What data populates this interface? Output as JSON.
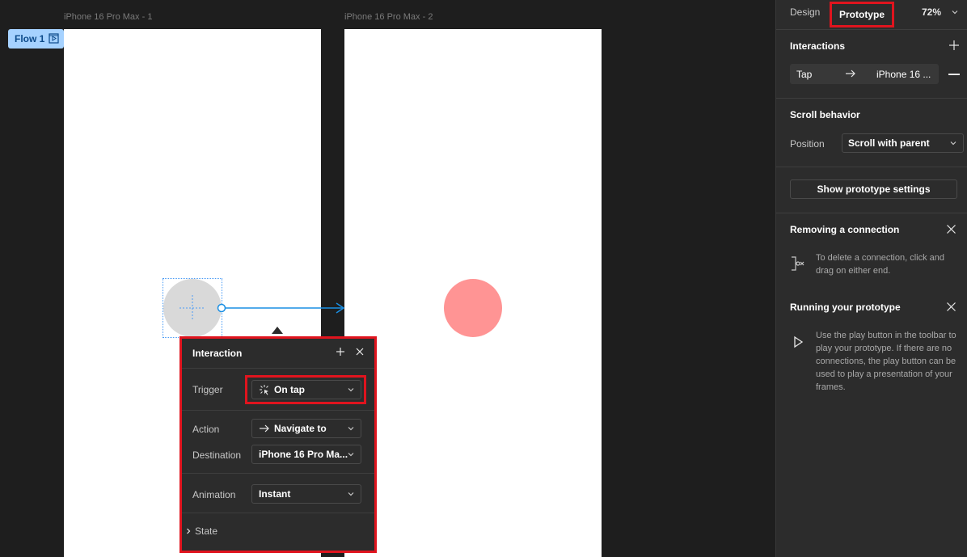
{
  "canvas": {
    "frame1_label": "iPhone 16 Pro Max - 1",
    "frame2_label": "iPhone 16 Pro Max - 2",
    "flow_chip_label": "Flow 1"
  },
  "interaction_popover": {
    "title": "Interaction",
    "trigger_label": "Trigger",
    "trigger_value": "On tap",
    "action_label": "Action",
    "action_value": "Navigate to",
    "destination_label": "Destination",
    "destination_value": "iPhone 16 Pro Ma...",
    "animation_label": "Animation",
    "animation_value": "Instant",
    "state_label": "State"
  },
  "panel": {
    "tabs": {
      "design": "Design",
      "prototype": "Prototype"
    },
    "zoom": "72%",
    "interactions_title": "Interactions",
    "interaction_row": {
      "trigger": "Tap",
      "destination": "iPhone 16 ..."
    },
    "scroll_title": "Scroll behavior",
    "position_label": "Position",
    "position_value": "Scroll with parent",
    "show_settings_button": "Show prototype settings",
    "removing_title": "Removing a connection",
    "removing_text": "To delete a connection, click and drag on either end.",
    "running_title": "Running your prototype",
    "running_text": "Use the play button in the toolbar to play your prototype. If there are no connections, the play button can be used to play a presentation of your frames."
  },
  "colors": {
    "accent_highlight": "#e0141e",
    "connection": "#1a8fe3",
    "gray_circle": "#d9d9d9",
    "red_circle": "#ff9494",
    "flow_chip": "#a6d2ff"
  }
}
